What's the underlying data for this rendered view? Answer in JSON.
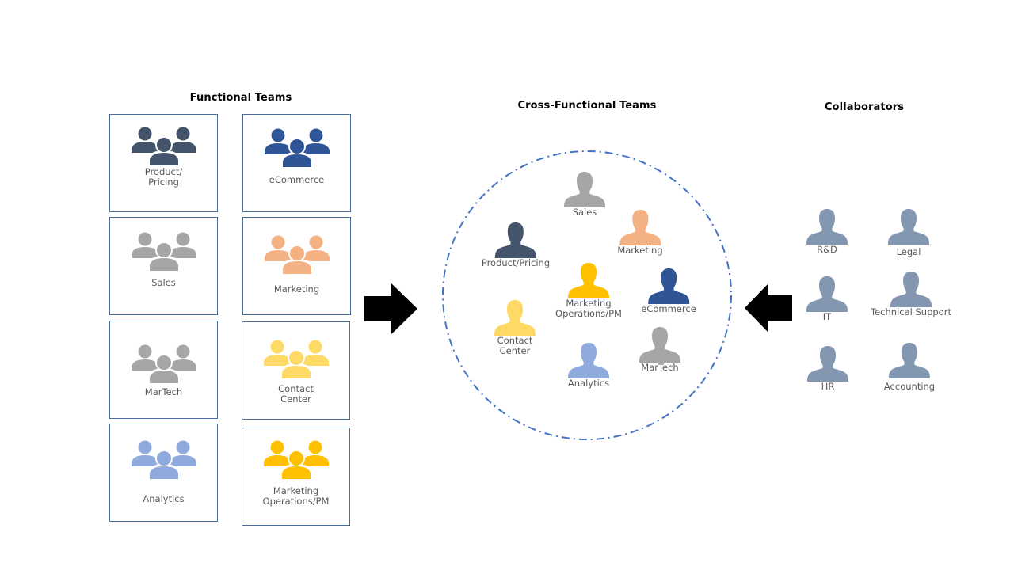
{
  "headings": {
    "functional": "Functional Teams",
    "cross_functional": "Cross-Functional Teams",
    "collaborators": "Collaborators"
  },
  "colors": {
    "product_pricing": "#44546a",
    "ecommerce": "#2f5597",
    "sales": "#a6a6a6",
    "marketing": "#f4b183",
    "martech": "#a6a6a6",
    "contact_center": "#ffd966",
    "analytics": "#8faadc",
    "marketing_ops": "#ffc000",
    "collaborator": "#8497b0",
    "box_border": "#4a6e9a",
    "circle_border": "#4472c4",
    "arrow": "#000000"
  },
  "functional_teams": [
    {
      "label": "Product/\nPricing",
      "color_key": "product_pricing"
    },
    {
      "label": "eCommerce",
      "color_key": "ecommerce"
    },
    {
      "label": "Sales",
      "color_key": "sales"
    },
    {
      "label": "Marketing",
      "color_key": "marketing"
    },
    {
      "label": "MarTech",
      "color_key": "martech"
    },
    {
      "label": "Contact\nCenter",
      "color_key": "contact_center"
    },
    {
      "label": "Analytics",
      "color_key": "analytics"
    },
    {
      "label": "Marketing\nOperations/PM",
      "color_key": "marketing_ops"
    }
  ],
  "cross_functional_members": [
    {
      "label": "Sales",
      "color_key": "sales"
    },
    {
      "label": "Marketing",
      "color_key": "marketing"
    },
    {
      "label": "Product/Pricing",
      "color_key": "product_pricing"
    },
    {
      "label": "Marketing\nOperations/PM",
      "color_key": "marketing_ops"
    },
    {
      "label": "eCommerce",
      "color_key": "ecommerce"
    },
    {
      "label": "Contact\nCenter",
      "color_key": "contact_center"
    },
    {
      "label": "MarTech",
      "color_key": "martech"
    },
    {
      "label": "Analytics",
      "color_key": "analytics"
    }
  ],
  "collaborators": [
    {
      "label": "R&D"
    },
    {
      "label": "Legal"
    },
    {
      "label": "IT"
    },
    {
      "label": "Technical Support"
    },
    {
      "label": "HR"
    },
    {
      "label": "Accounting"
    }
  ],
  "arrows": [
    {
      "name": "functional-to-cross-arrow",
      "direction": "right"
    },
    {
      "name": "collaborators-to-cross-arrow",
      "direction": "left"
    }
  ]
}
